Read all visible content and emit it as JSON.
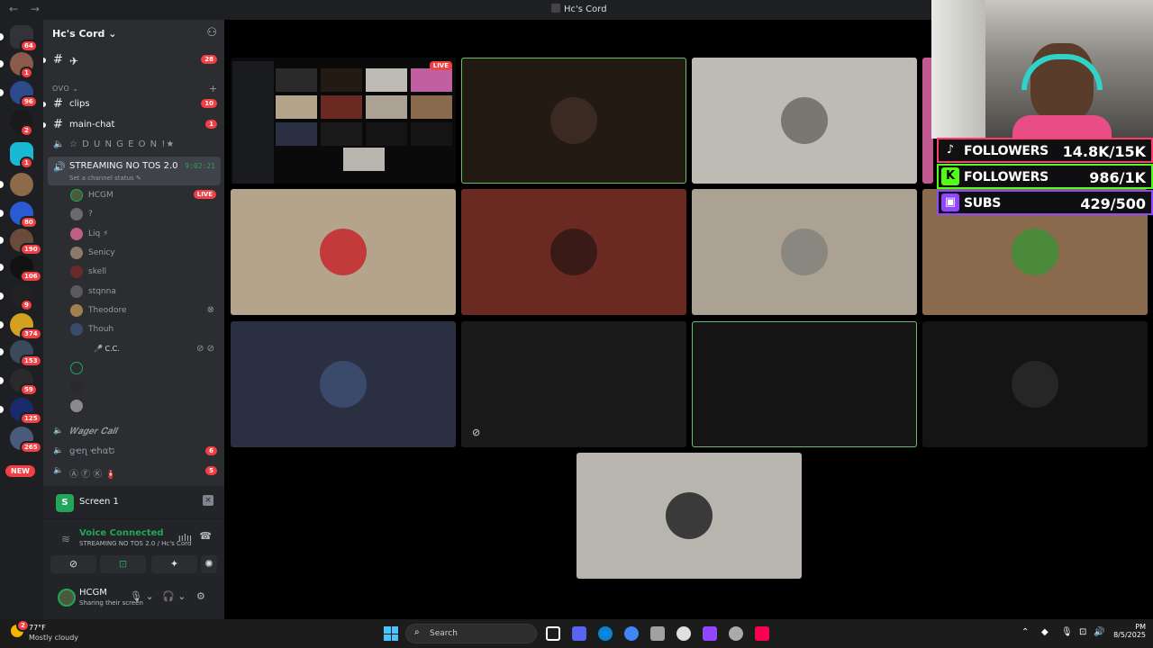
{
  "window": {
    "title": "Hc's Cord",
    "back": "←",
    "forward": "→"
  },
  "server": {
    "name": "Hc's Cord ⌄",
    "invite_icon": "add-member-icon"
  },
  "rail": {
    "servers": [
      {
        "badge": "64",
        "color": "#5865f2"
      },
      {
        "badge": "1",
        "color": "#8a5a4a"
      },
      {
        "badge": "96",
        "color": "#2c4a8c"
      },
      {
        "badge": "2",
        "color": "#1a1a1a"
      },
      {
        "badge": "1",
        "color": "#19b9d4"
      },
      {
        "badge": "",
        "color": "#8c6a4a"
      },
      {
        "badge": "80",
        "color": "#2a5ad4"
      },
      {
        "badge": "190",
        "color": "#6a4a3a"
      },
      {
        "badge": "106",
        "color": "#111111"
      },
      {
        "badge": "9",
        "color": "#222222"
      },
      {
        "badge": "374",
        "color": "#d4a020"
      },
      {
        "badge": "153",
        "color": "#3a4a5a"
      },
      {
        "badge": "59",
        "color": "#2a2a2a"
      },
      {
        "badge": "125",
        "color": "#1a2a6a"
      },
      {
        "badge": "265",
        "color": "#4a5a7a"
      }
    ],
    "new_label": "NEW"
  },
  "channels": {
    "top": [
      {
        "icon": "#",
        "name": "✈",
        "count": "28",
        "unread": true
      },
      {
        "icon": "#",
        "name": "clips",
        "count": "10",
        "unread": true
      },
      {
        "icon": "#",
        "name": "main-chat",
        "count": "1",
        "unread": true
      }
    ],
    "category": "OVO ⌄",
    "category_add": "+",
    "dungeon": {
      "icon": "🔈",
      "name": "☆ D U N G E O N !★"
    },
    "active": {
      "icon": "🔊",
      "name": "STREAMING NO TOS 2.0",
      "timer": "9:02:21",
      "status": "Set a channel status ✎"
    },
    "members": [
      {
        "name": "HCGM",
        "live": "LIVE",
        "color": "#4a5a3a"
      },
      {
        "name": "?",
        "live": "",
        "color": "#6a6a6a"
      },
      {
        "name": "Liq ⚡",
        "live": "",
        "color": "#c06080"
      },
      {
        "name": "Senicy",
        "live": "",
        "color": "#8a7a6a"
      },
      {
        "name": "skell",
        "live": "",
        "color": "#6a2a2a"
      },
      {
        "name": "stqnna",
        "live": "",
        "color": "#5a5a5a"
      },
      {
        "name": "Theodore",
        "live": "",
        "color": "#a08050",
        "icon": "⊗"
      },
      {
        "name": "Thouh",
        "live": "",
        "color": "#3a4a6a"
      },
      {
        "name": "🎤 C.C.",
        "live": "",
        "color": "",
        "icon": "⊘ ⊘"
      },
      {
        "name": "",
        "live": "",
        "color": "#23a55a"
      },
      {
        "name": "",
        "live": "",
        "color": "#2a2a2a"
      },
      {
        "name": "",
        "live": "",
        "color": "#8a8a8a"
      }
    ],
    "bottom": [
      {
        "icon": "🔈",
        "name": "𝑾𝒂𝒈𝒆𝒓 𝑪𝒂𝒍𝒍",
        "count": ""
      },
      {
        "icon": "🔈",
        "name": "ցҽղ ҽհαԵ",
        "count": "6"
      },
      {
        "icon": "🔈",
        "name": "Ⓐ Ⓕ Ⓚ 🧯",
        "count": "5"
      }
    ]
  },
  "screen_panel": {
    "icon_letter": "S",
    "label": "Screen 1",
    "close": "×"
  },
  "voice_panel": {
    "status": "Voice Connected",
    "location": "STREAMING NO TOS 2.0 / Hc's Cord",
    "signal_icon": "≋",
    "noise_icon": "ıılıı",
    "disconnect_icon": "☎",
    "buttons": [
      "⊘",
      "⊡",
      "✦",
      "✺"
    ]
  },
  "user_panel": {
    "name": "HCGM",
    "status": "Sharing their screen",
    "mic_icon": "🎙 ⌄",
    "headset_icon": "🎧 ⌄",
    "settings_icon": "⚙"
  },
  "stream_tile": {
    "live_label": "LIVE"
  },
  "tiles": [
    {
      "bg": "#241a14",
      "avatar": "#3a2a22",
      "speaking": true
    },
    {
      "bg": "#bebab4",
      "avatar": "#7a7672",
      "speaking": false
    },
    {
      "bg": "#b4a48c",
      "avatar": "#c23a3a",
      "speaking": false
    },
    {
      "bg": "#6a2a22",
      "avatar": "#3a1a16",
      "speaking": false
    },
    {
      "bg": "#aca294",
      "avatar": "#8a8680",
      "speaking": false
    },
    {
      "bg": "#8a6a4c",
      "avatar": "#4a8a3a",
      "speaking": false
    },
    {
      "bg": "#2a2f42",
      "avatar": "#3a4a6a",
      "speaking": false
    },
    {
      "bg": "#1a1a1a",
      "avatar": "",
      "speaking": false,
      "muted": "⊘"
    },
    {
      "bg": "#141414",
      "avatar": "",
      "speaking": true
    },
    {
      "bg": "#141414",
      "avatar": "#262626",
      "speaking": false
    },
    {
      "bg": "#b8b4ae",
      "avatar": "#3a3a3a",
      "speaking": false
    }
  ],
  "overlay": {
    "rows": [
      {
        "icon": "♪",
        "label": "FOLLOWERS",
        "value": "14.8K/15K",
        "color": "#ff3b6b",
        "icon_bg": "#111111"
      },
      {
        "icon": "K",
        "label": "FOLLOWERS",
        "value": "986/1K",
        "color": "#53fc18",
        "icon_bg": "#53fc18"
      },
      {
        "icon": "▣",
        "label": "SUBS",
        "value": "429/500",
        "color": "#9146ff",
        "icon_bg": "#9146ff"
      }
    ]
  },
  "taskbar": {
    "weather_temp": "77°F",
    "weather_desc": "Mostly cloudy",
    "weather_badge": "2",
    "search_placeholder": "Search",
    "search_icon": "⌕",
    "apps": [
      "#ffffff",
      "#5865f2",
      "#0a84d8",
      "#4285f4",
      "#a0a0a0",
      "#e0e0e0",
      "#9146ff",
      "#aaaaaa",
      "#ff0050"
    ],
    "tray": [
      "⌃",
      "◆",
      "🎙",
      "⊡",
      "🔊"
    ],
    "clock_time": "PM",
    "clock_date": "8/5/2025"
  }
}
